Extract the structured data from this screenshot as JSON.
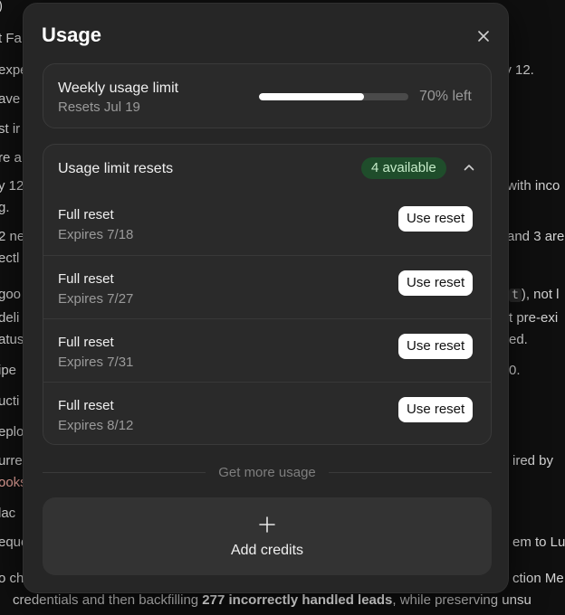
{
  "background": {
    "lines": [
      ")",
      "t Fa",
      "expe",
      "ave",
      "st ir",
      "re a",
      "y 12",
      "g.",
      "2 ne",
      "ectl",
      "goo",
      "deli",
      "atus",
      "ipe",
      "ucti",
      "eplo",
      "urre",
      "ooks",
      "lac",
      "eque",
      "o ch"
    ],
    "right_fragments": [
      "ly 12.",
      "with inco",
      "and 3 are",
      "), not l",
      "t pre-exi",
      "ed.",
      "0.",
      "ired by",
      "em to Lu",
      "ction Me"
    ],
    "code_fragment": "t",
    "bottom_line_pre": "credentials and then backfilling ",
    "bottom_line_bold": "277 incorrectly handled leads",
    "bottom_line_post": ", while preserving unsu"
  },
  "modal": {
    "title": "Usage",
    "weekly": {
      "title": "Weekly usage limit",
      "subtitle": "Resets Jul 19",
      "progress_fraction": 0.7,
      "percent_label": "70% left"
    },
    "resets": {
      "title": "Usage limit resets",
      "badge": "4 available",
      "items": [
        {
          "name": "Full reset",
          "expires": "Expires 7/18",
          "button": "Use reset"
        },
        {
          "name": "Full reset",
          "expires": "Expires 7/27",
          "button": "Use reset"
        },
        {
          "name": "Full reset",
          "expires": "Expires 7/31",
          "button": "Use reset"
        },
        {
          "name": "Full reset",
          "expires": "Expires 8/12",
          "button": "Use reset"
        }
      ]
    },
    "divider_text": "Get more usage",
    "add_credits": "Add credits"
  }
}
